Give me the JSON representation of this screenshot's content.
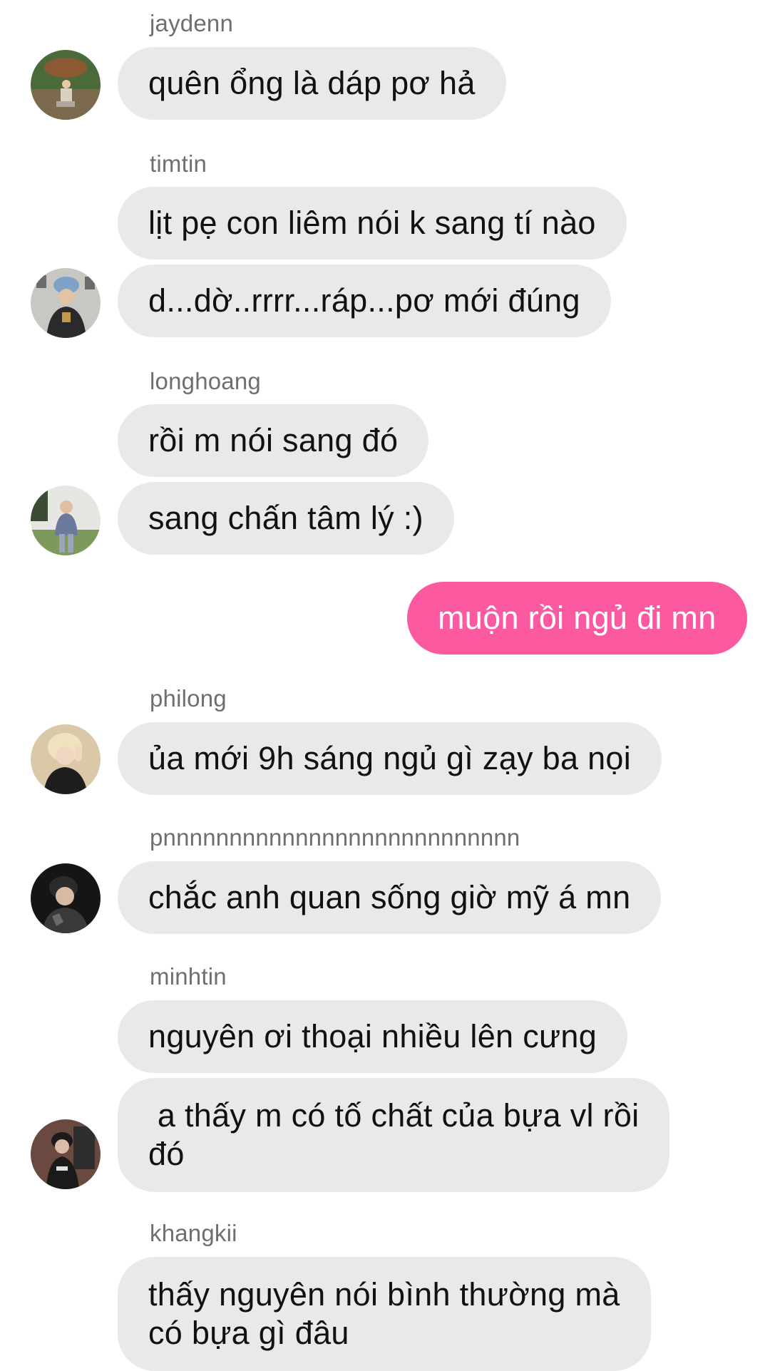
{
  "messages": [
    {
      "sender": "jaydenn",
      "text": "quên ổng là dáp pơ hả"
    },
    {
      "sender": "timtin",
      "text1": "lịt pẹ con liêm nói k sang tí nào",
      "text2": "d...dờ..rrrr...ráp...pơ mới đúng"
    },
    {
      "sender": "longhoang",
      "text1": "rồi m nói sang đó",
      "text2": "sang chấn tâm lý :)"
    },
    {
      "sender": "",
      "text": "muộn rồi ngủ đi mn"
    },
    {
      "sender": "philong",
      "text": "ủa mới 9h sáng ngủ gì zạy ba nọi"
    },
    {
      "sender": "pnnnnnnnnnnnnnnnnnnnnnnnnnnn",
      "text": "chắc anh quan sống giờ mỹ á mn"
    },
    {
      "sender": "minhtin",
      "text1": "nguyên ơi thoại nhiều lên cưng",
      "text2": " a thấy m có tố chất của bựa vl rồi\nđó"
    },
    {
      "sender": "khangkii",
      "text1": "thấy nguyên nói bình thường mà\ncó bựa gì đâu"
    }
  ],
  "colors": {
    "bubble_other": "#e9e9e9",
    "bubble_mine": "#fb5aa1",
    "sender_name": "#6f6f6f"
  }
}
